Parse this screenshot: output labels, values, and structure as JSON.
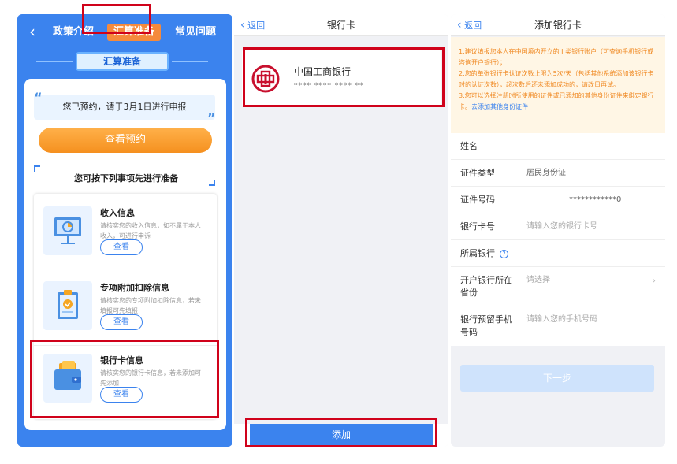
{
  "panel1": {
    "tabs": [
      "政策介绍",
      "汇算准备",
      "常见问题"
    ],
    "ribbon_label": "汇算准备",
    "notice": "您已预约，请于3月1日进行申报",
    "view_reservation_button": "查看预约",
    "prep_title": "您可按下列事项先进行准备",
    "items": [
      {
        "title": "收入信息",
        "desc": "请核实您的收入信息，如不属于本人收入，可进行申诉",
        "button": "查看",
        "icon": "presentation-chart-icon"
      },
      {
        "title": "专项附加扣除信息",
        "desc": "请核实您的专项附加扣除信息，若未填报可先填报",
        "button": "查看",
        "icon": "clipboard-check-icon"
      },
      {
        "title": "银行卡信息",
        "desc": "请核实您的银行卡信息，若未添加可先添加",
        "button": "查看",
        "icon": "wallet-icon"
      }
    ]
  },
  "panel2": {
    "back_label": "返回",
    "title": "银行卡",
    "bank_name": "中国工商银行",
    "card_number": "**** **** **** **",
    "add_button": "添加"
  },
  "panel3": {
    "back_label": "返回",
    "title": "添加银行卡",
    "tips": [
      "1.建议填报您本人在中国境内开立的 I 类银行账户（可查询手机银行或咨询开户银行）；",
      "2.您的单张银行卡认证次数上限为5次/天（包括其他系统添加该银行卡时的认证次数），超次数后还未添加成功的，请改日再试。",
      "3.您可以选择注册时所使用的证件或已添加的其他身份证件来绑定银行卡。"
    ],
    "tips_link": "去添加其他身份证件",
    "fields": {
      "name_label": "姓名",
      "id_type_label": "证件类型",
      "id_type_value": "居民身份证",
      "id_number_label": "证件号码",
      "id_number_value": "************0",
      "card_number_label": "银行卡号",
      "card_number_placeholder": "请输入您的银行卡号",
      "bank_label": "所属银行",
      "province_label_1": "开户银行所在",
      "province_label_2": "省份",
      "province_placeholder": "请选择",
      "phone_label_1": "银行预留手机",
      "phone_label_2": "号码",
      "phone_placeholder": "请输入您的手机号码"
    },
    "next_button": "下一步"
  },
  "colors": {
    "primary_blue": "#3b83ee",
    "orange": "#f58a3c",
    "highlight_red": "#d0021b",
    "tips_orange": "#f08a24"
  }
}
